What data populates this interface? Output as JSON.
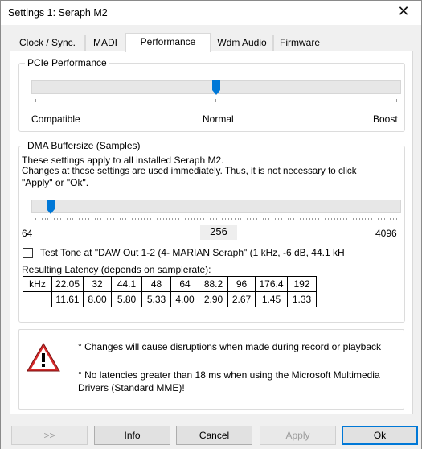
{
  "window": {
    "title": "Settings 1: Seraph M2",
    "close_glyph": "✕"
  },
  "tabs": [
    {
      "label": "Clock / Sync."
    },
    {
      "label": "MADI"
    },
    {
      "label": "Performance"
    },
    {
      "label": "Wdm Audio"
    },
    {
      "label": "Firmware"
    }
  ],
  "active_tab": "Performance",
  "pcie": {
    "legend": "PCIe Performance",
    "labels": {
      "left": "Compatible",
      "mid": "Normal",
      "right": "Boost"
    },
    "slider_value": "Normal",
    "slider_level": 0.5
  },
  "dma": {
    "legend": "DMA Buffersize (Samples)",
    "desc_line1": "These settings apply to all installed Seraph M2.",
    "desc_line2": "Changes at these settings are used immediately. Thus, it is not necessary to click",
    "desc_line3": "\"Apply\" or \"Ok\".",
    "min_label": "64",
    "max_label": "4096",
    "value": "256",
    "slider_level": 0.04,
    "test_tone_label": "Test Tone at \"DAW Out  1-2 (4- MARIAN Seraph\" (1 kHz, -6 dB,  44.1 kH",
    "test_tone_checked": false,
    "latency_title": "Resulting Latency (depends on samplerate):",
    "latency_table": {
      "header": [
        "kHz",
        "22.05",
        "32",
        "44.1",
        "48",
        "64",
        "88.2",
        "96",
        "176.4",
        "192"
      ],
      "row": [
        "",
        "11.61",
        "8.00",
        "5.80",
        "5.33",
        "4.00",
        "2.90",
        "2.67",
        "1.45",
        "1.33"
      ]
    }
  },
  "warning": {
    "icon": "warning-triangle-icon",
    "line1": "° Changes will cause disruptions when made during record or playback",
    "line2a": "° No latencies greater than 18 ms when using the Microsoft Multimedia",
    "line2b": "Drivers (Standard MME)!"
  },
  "buttons": {
    "more": ">>",
    "info": "Info",
    "cancel": "Cancel",
    "apply": "Apply",
    "ok": "Ok"
  },
  "colors": {
    "slider_thumb": "#0078d7",
    "warning_red": "#d42a2a",
    "default_border": "#0078d7"
  }
}
